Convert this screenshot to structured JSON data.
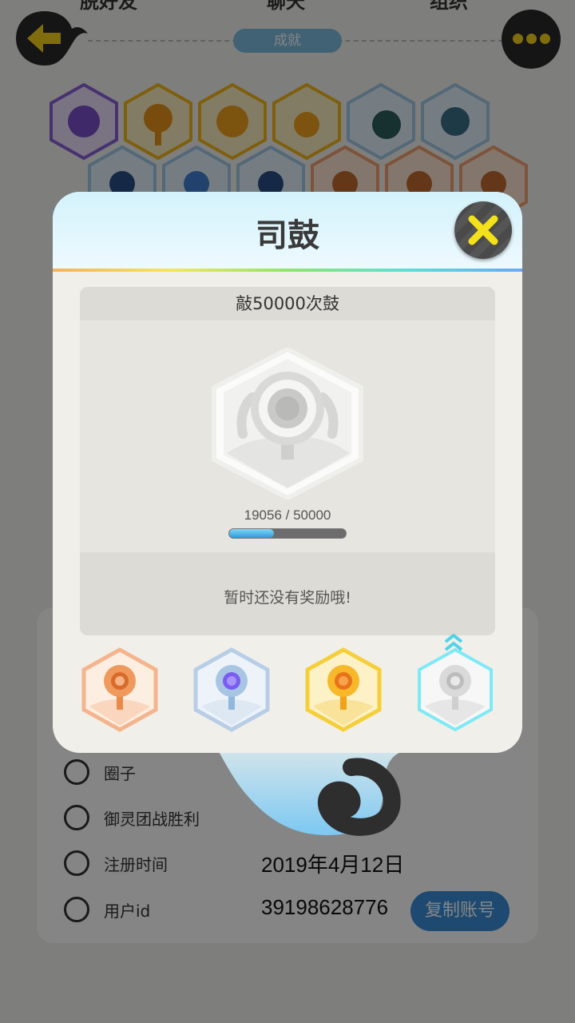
{
  "top_tabs": [
    "脱好友",
    "聊天",
    "组织"
  ],
  "section_pill": "成就",
  "info_rows": [
    {
      "icon": "circle-icon",
      "label": "圈子",
      "value": ""
    },
    {
      "icon": "person-icon",
      "label": "御灵团战胜利",
      "value": ""
    },
    {
      "icon": "clock-icon",
      "label": "注册时间",
      "value": "2019年4月12日"
    },
    {
      "icon": "id-icon",
      "label": "用户id",
      "value": "39198628776"
    }
  ],
  "copy_button": "复制账号",
  "modal": {
    "title": "司鼓",
    "task": "敲50000次鼓",
    "progress_text": "19056 / 50000",
    "progress_fraction": 0.381,
    "reward_text": "暂时还没有奖励哦!",
    "tiers": [
      {
        "name": "bronze",
        "color": "#f0a070"
      },
      {
        "name": "silver",
        "color": "#9fbfe0"
      },
      {
        "name": "gold",
        "color": "#f7c430"
      },
      {
        "name": "platinum",
        "color": "#7ee9f7"
      }
    ]
  },
  "colors": {
    "accent_yellow": "#f3d21a",
    "progress_blue": "#2f9ad8",
    "copy_blue": "#3b8fd9"
  }
}
